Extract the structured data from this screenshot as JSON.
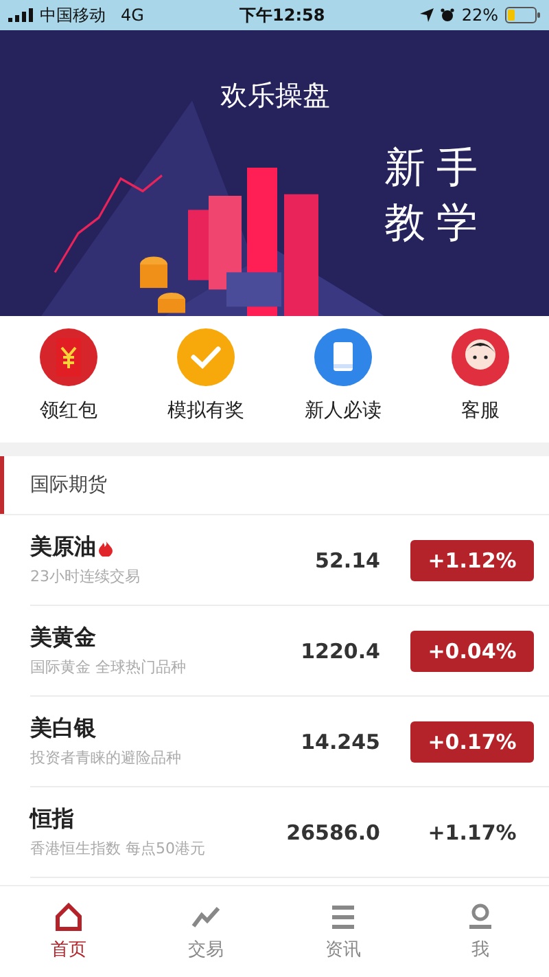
{
  "status_bar": {
    "carrier": "中国移动",
    "network": "4G",
    "time": "下午12:58",
    "battery": "22%"
  },
  "banner": {
    "title": "欢乐操盘",
    "caption": [
      "新手",
      "教学"
    ]
  },
  "quick_links": [
    {
      "label": "领红包"
    },
    {
      "label": "模拟有奖"
    },
    {
      "label": "新人必读"
    },
    {
      "label": "客服"
    }
  ],
  "section": {
    "title": "国际期货"
  },
  "quotes": [
    {
      "name": "美原油",
      "hot": true,
      "subtitle": "23小时连续交易",
      "price": "52.14",
      "change": "+1.12%",
      "kind": "badge"
    },
    {
      "name": "美黄金",
      "hot": false,
      "subtitle": "国际黄金 全球热门品种",
      "price": "1220.4",
      "change": "+0.04%",
      "kind": "badge"
    },
    {
      "name": "美白银",
      "hot": false,
      "subtitle": "投资者青睐的避险品种",
      "price": "14.245",
      "change": "+0.17%",
      "kind": "badge"
    },
    {
      "name": "恒指",
      "hot": false,
      "subtitle": "香港恒生指数 每点50港元",
      "price": "26586.0",
      "change": "+1.17%",
      "kind": "plain"
    }
  ],
  "tabs": [
    {
      "label": "首页",
      "selected": true
    },
    {
      "label": "交易",
      "selected": false
    },
    {
      "label": "资讯",
      "selected": false
    },
    {
      "label": "我",
      "selected": false
    }
  ]
}
